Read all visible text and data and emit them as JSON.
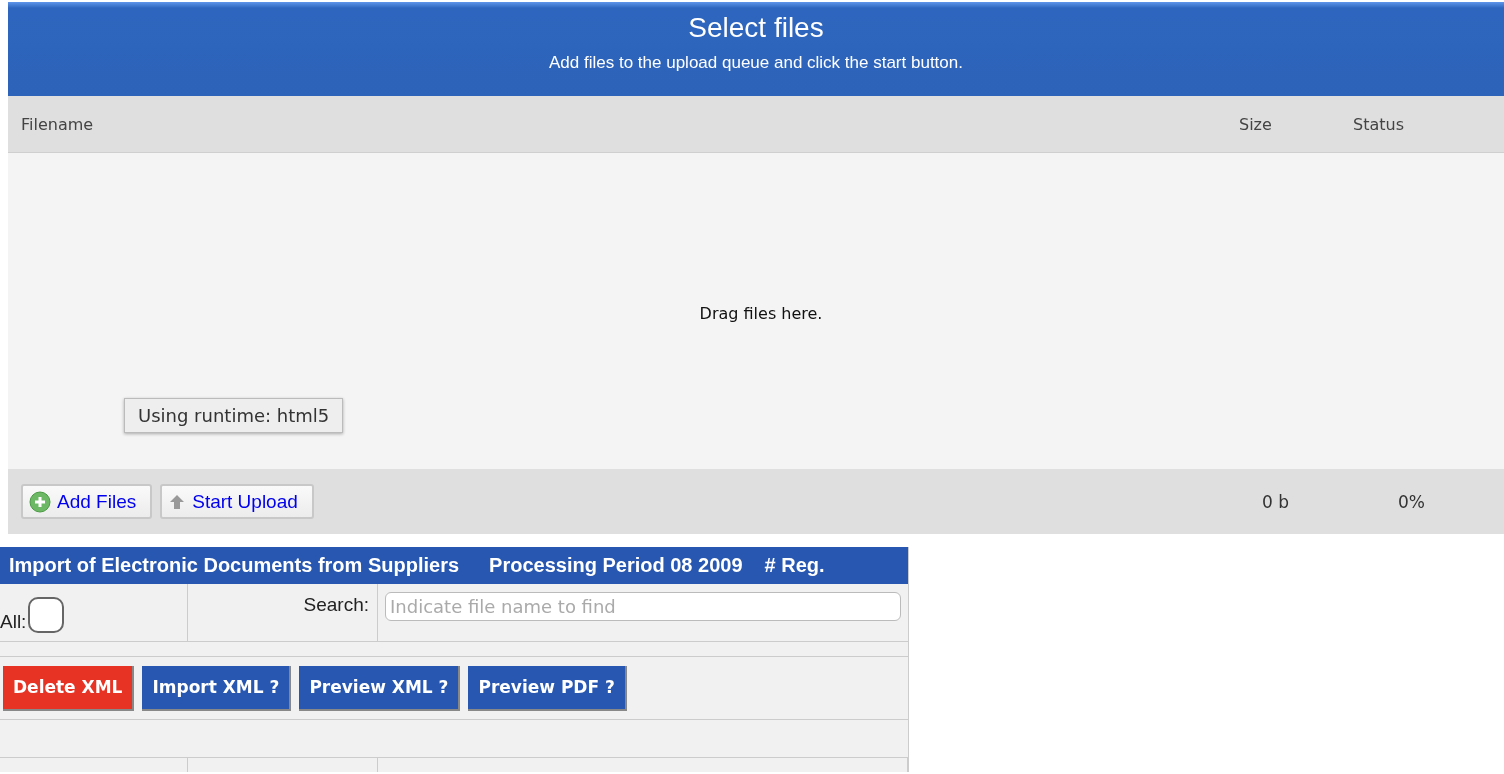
{
  "uploader": {
    "title": "Select files",
    "subtitle": "Add files to the upload queue and click the start button.",
    "columns": [
      "Filename",
      "Size",
      "Status"
    ],
    "drop_hint": "Drag files here.",
    "runtime_tooltip": "Using runtime: html5",
    "buttons": [
      {
        "kind": "add",
        "label": "Add Files"
      },
      {
        "kind": "upload",
        "label": "Start Upload"
      }
    ],
    "total_size": "0 b",
    "total_status": "0%"
  },
  "import_panel": {
    "title": "Import of Electronic Documents from Suppliers",
    "period": "Processing Period 08 2009",
    "reg": "# Reg.",
    "all_label": "All:",
    "all_checked": false,
    "search_label": "Search:",
    "search_placeholder": "Indicate file name to find",
    "actions": [
      {
        "kind": "danger",
        "label": "Delete XML"
      },
      {
        "kind": "primary",
        "label": "Import XML ?"
      },
      {
        "kind": "primary",
        "label": "Preview XML ?"
      },
      {
        "kind": "primary",
        "label": "Preview PDF ?"
      }
    ]
  }
}
